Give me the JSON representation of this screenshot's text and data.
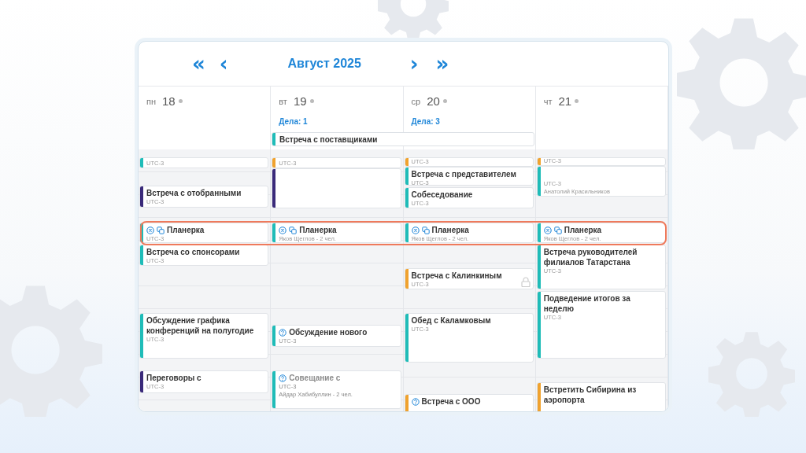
{
  "header": {
    "month": "Август 2025",
    "nav_prev_year": "«",
    "nav_prev": "‹",
    "nav_next": "›",
    "nav_next_year": "»"
  },
  "days": [
    {
      "weekday": "пн",
      "date": "18"
    },
    {
      "weekday": "вт",
      "date": "19",
      "tasks": "Дела: 1"
    },
    {
      "weekday": "ср",
      "date": "20",
      "tasks": "Дела: 3"
    },
    {
      "weekday": "чт",
      "date": "21"
    }
  ],
  "all_day_event": {
    "title": "Встреча с поставщиками",
    "color": "#1fbcb8"
  },
  "highlighted_row": true,
  "columns": [
    {
      "events": [
        {
          "lines": [
            "UTC-3"
          ],
          "color": "#1fbcb8"
        },
        {
          "kind": "plain",
          "title": "Встреча с отобранными",
          "lines": [
            "UTC-3"
          ],
          "color": "#3a2a7a"
        },
        {
          "kind": "recurring",
          "title": "Планерка",
          "lines": [
            "UTC-3"
          ],
          "color": "#1fbcb8"
        },
        {
          "kind": "plain",
          "title": "Встреча со спонсорами",
          "lines": [
            "UTC-3"
          ],
          "color": "#1fbcb8"
        },
        {
          "kind": "plain",
          "title": "Обсуждение графика конференций на полугодие",
          "lines": [
            "UTC-3"
          ],
          "color": "#1fbcb8"
        },
        {
          "kind": "plain",
          "title": "Переговоры с",
          "lines": [
            "UTC-3"
          ],
          "color": "#3a2a7a"
        }
      ]
    },
    {
      "events": [
        {
          "lines": [
            "UTC-3"
          ],
          "color": "#f0a22e"
        },
        {
          "color": "#3a2a7a"
        },
        {
          "kind": "recurring",
          "title": "Планерка",
          "lines": [
            "Яков Щеглов - 2 чел."
          ],
          "color": "#1fbcb8"
        },
        {
          "kind": "question",
          "title": "Обсуждение нового",
          "lines": [
            "UTC-3"
          ],
          "color": "#1fbcb8"
        },
        {
          "kind": "question",
          "title": "Совещание с",
          "lines": [
            "UTC-3",
            "Айдар Хабибуллин - 2 чел."
          ],
          "color": "#1fbcb8",
          "dimmed": true
        }
      ]
    },
    {
      "events": [
        {
          "lines": [
            "UTC-3"
          ],
          "color": "#f0a22e"
        },
        {
          "kind": "plain",
          "title": "Встреча с представителем",
          "lines": [
            "UTC-3"
          ],
          "color": "#1fbcb8"
        },
        {
          "kind": "plain",
          "title": "Собеседование",
          "lines": [
            "UTC-3"
          ],
          "color": "#1fbcb8"
        },
        {
          "kind": "recurring",
          "title": "Планерка",
          "lines": [
            "Яков Щеглов - 2 чел."
          ],
          "color": "#1fbcb8"
        },
        {
          "kind": "plain",
          "title": "Встреча с Калинкиным",
          "lines": [
            "UTC-3"
          ],
          "color": "#f0a22e",
          "locked": true
        },
        {
          "kind": "plain",
          "title": "Обед с Каламковым",
          "lines": [
            "UTC-3"
          ],
          "color": "#1fbcb8"
        },
        {
          "kind": "question",
          "title": "Встреча с ООО",
          "color": "#f0a22e"
        }
      ]
    },
    {
      "events": [
        {
          "lines": [
            "UTC-3"
          ],
          "color": "#f0a22e"
        },
        {
          "lines": [
            "UTC-3",
            "Анатолий Красильников"
          ],
          "color": "#1fbcb8"
        },
        {
          "kind": "recurring",
          "title": "Планерка",
          "lines": [
            "Яков Щеглов - 2 чел."
          ],
          "color": "#1fbcb8"
        },
        {
          "kind": "plain",
          "title": "Встреча руководителей филиалов Татарстана",
          "lines": [
            "UTC-3"
          ],
          "color": "#1fbcb8"
        },
        {
          "kind": "plain",
          "title": "Подведение итогов за неделю",
          "lines": [
            "UTC-3"
          ],
          "color": "#1fbcb8"
        },
        {
          "kind": "plain",
          "title": "Встретить Сибирина из аэропорта",
          "color": "#f0a22e"
        }
      ]
    }
  ]
}
